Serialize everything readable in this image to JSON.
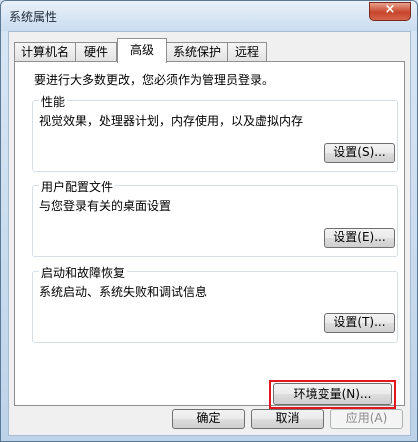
{
  "window": {
    "title": "系统属性",
    "close_label": "×"
  },
  "tabs": [
    {
      "label": "计算机名",
      "active": false
    },
    {
      "label": "硬件",
      "active": false
    },
    {
      "label": "高级",
      "active": true
    },
    {
      "label": "系统保护",
      "active": false
    },
    {
      "label": "远程",
      "active": false
    }
  ],
  "advanced": {
    "admin_note": "要进行大多数更改，您必须作为管理员登录。",
    "performance": {
      "title": "性能",
      "description": "视觉效果，处理器计划，内存使用，以及虚拟内存",
      "button": "设置(S)..."
    },
    "user_profiles": {
      "title": "用户配置文件",
      "description": "与您登录有关的桌面设置",
      "button": "设置(E)..."
    },
    "startup_recovery": {
      "title": "启动和故障恢复",
      "description": "系统启动、系统失败和调试信息",
      "button": "设置(T)..."
    },
    "env_button": "环境变量(N)..."
  },
  "footer": {
    "ok": "确定",
    "cancel": "取消",
    "apply": "应用(A)"
  },
  "colors": {
    "highlight": "#e3161e"
  }
}
